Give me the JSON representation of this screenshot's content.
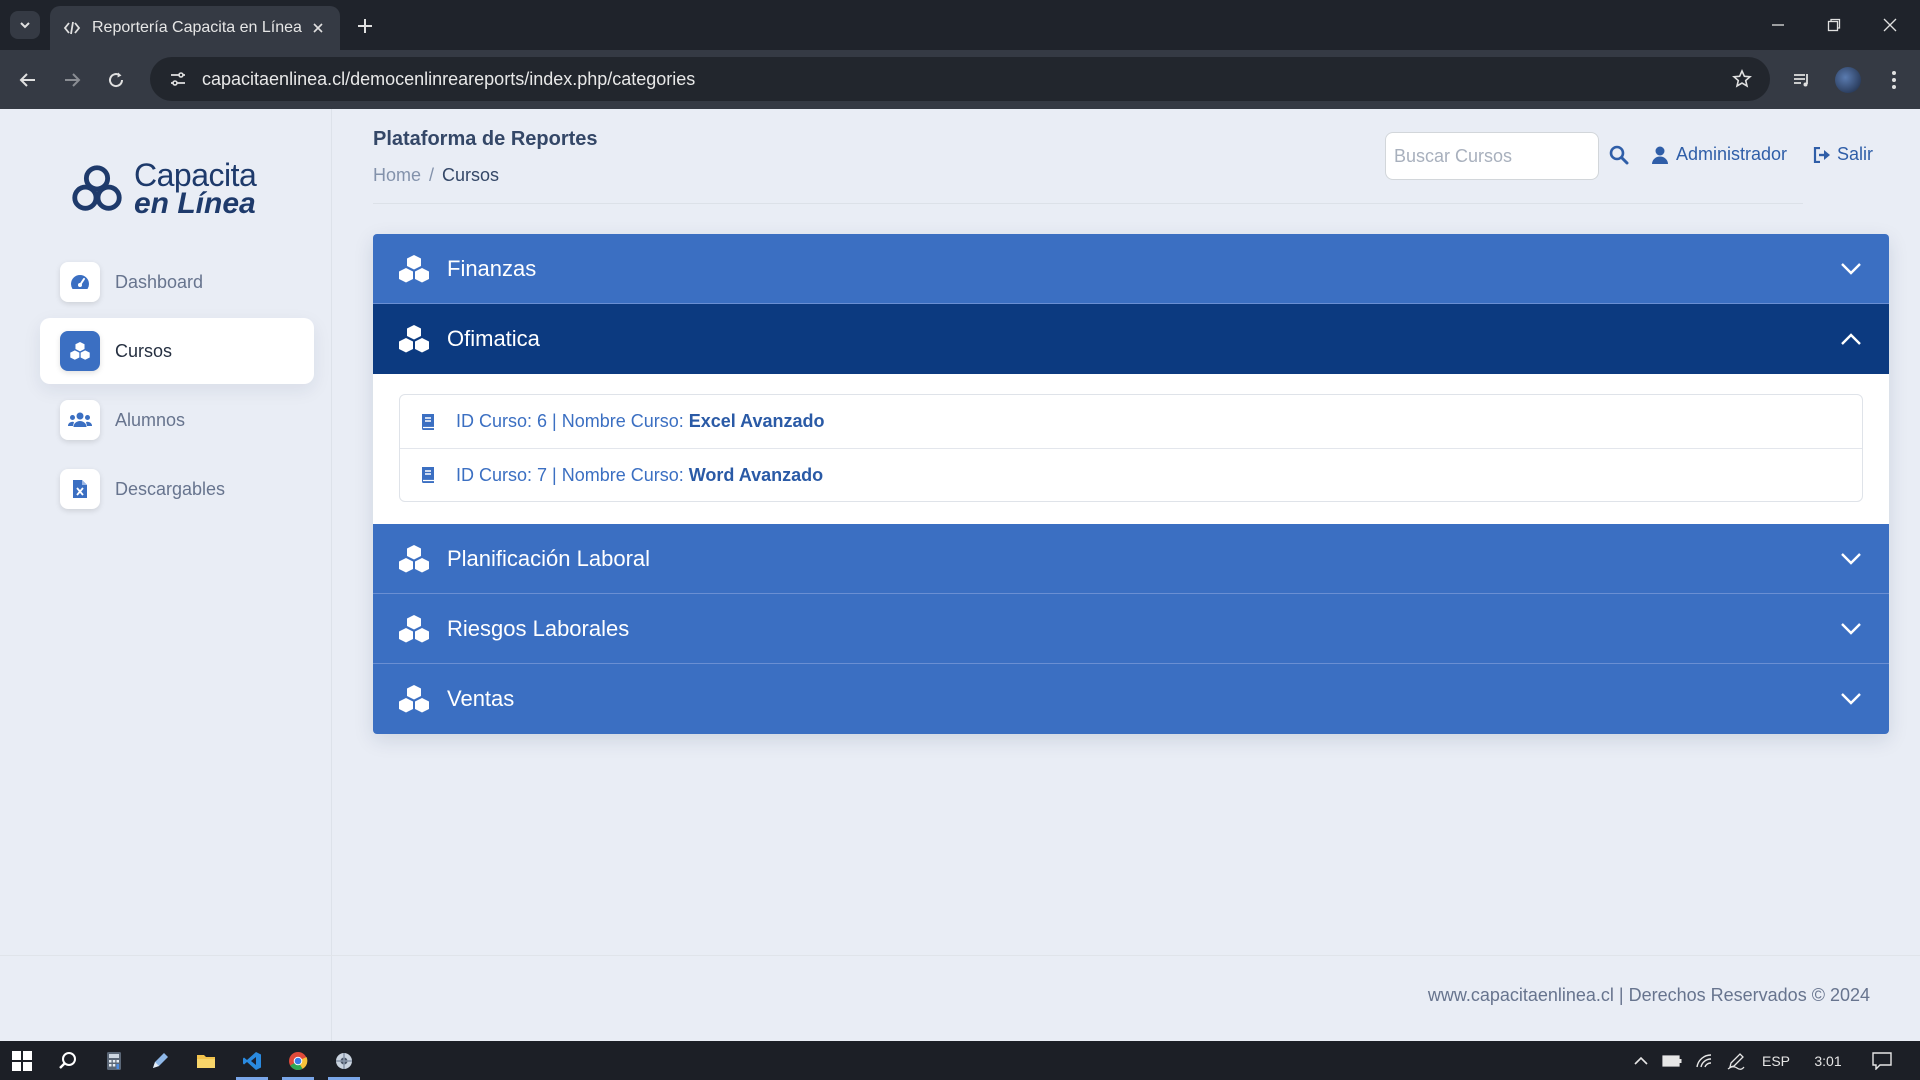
{
  "browser": {
    "tab_title": "Reportería Capacita en Línea",
    "url": "capacitaenlinea.cl/democenlinreareports/index.php/categories"
  },
  "sidebar": {
    "logo_line1": "Capacita",
    "logo_line2": "en Línea",
    "items": [
      {
        "label": "Dashboard",
        "icon": "gauge-icon",
        "active": false
      },
      {
        "label": "Cursos",
        "icon": "cubes-icon",
        "active": true
      },
      {
        "label": "Alumnos",
        "icon": "users-icon",
        "active": false
      },
      {
        "label": "Descargables",
        "icon": "file-excel-icon",
        "active": false
      }
    ]
  },
  "header": {
    "title": "Plataforma de Reportes",
    "breadcrumb_home": "Home",
    "breadcrumb_sep": "/",
    "breadcrumb_current": "Cursos",
    "search_placeholder": "Buscar Cursos",
    "user_label": "Administrador",
    "logout_label": "Salir"
  },
  "categories": [
    {
      "name": "Finanzas",
      "open": false
    },
    {
      "name": "Ofimatica",
      "open": true,
      "courses": [
        {
          "prefix": "ID Curso: 6 | Nombre Curso:",
          "name": "Excel Avanzado"
        },
        {
          "prefix": "ID Curso: 7 | Nombre Curso:",
          "name": "Word Avanzado"
        }
      ]
    },
    {
      "name": "Planificación Laboral",
      "open": false
    },
    {
      "name": "Riesgos Laborales",
      "open": false
    },
    {
      "name": "Ventas",
      "open": false
    }
  ],
  "footer": {
    "text": "www.capacitaenlinea.cl | Derechos Reservados © 2024"
  },
  "taskbar": {
    "language": "ESP",
    "time": "3:01"
  },
  "colors": {
    "primary": "#3b6fc2",
    "primary_dark": "#0c3a80",
    "page_bg": "#e9edf5"
  }
}
